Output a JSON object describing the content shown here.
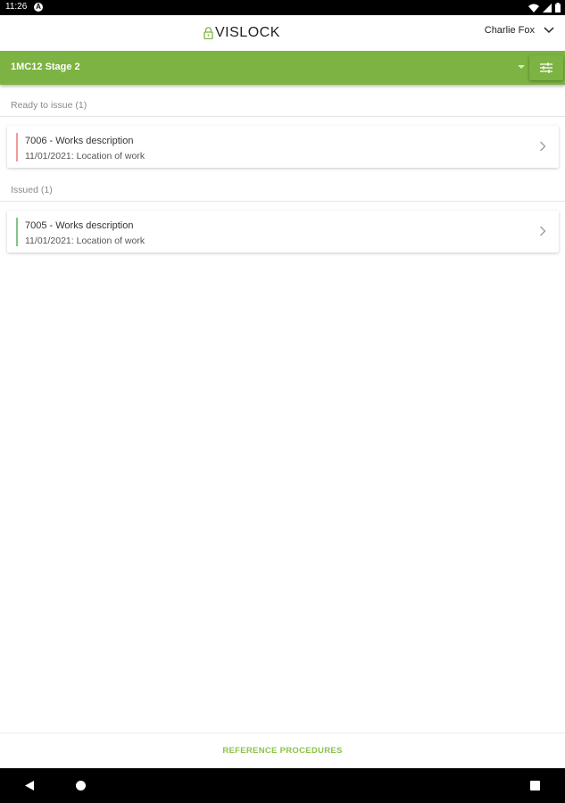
{
  "status_bar": {
    "time": "11:26",
    "notification_icon": "a-circle-icon",
    "icons": [
      "wifi-icon",
      "signal-icon",
      "battery-icon"
    ]
  },
  "header": {
    "logo_text": "VISLOCK",
    "logo_icon": "lock-icon",
    "user_name": "Charlie Fox",
    "user_menu_icon": "chevron-down-icon"
  },
  "toolbar": {
    "project": "1MC12 Stage 2",
    "filter_icon": "sliders-icon"
  },
  "sections": [
    {
      "label": "Ready to issue (1)",
      "items": [
        {
          "title": "7006 - Works description",
          "subtitle": "11/01/2021: Location of work",
          "status_color": "#ef9a9a"
        }
      ]
    },
    {
      "label": "Issued (1)",
      "items": [
        {
          "title": "7005 - Works description",
          "subtitle": "11/01/2021: Location of work",
          "status_color": "#81c784"
        }
      ]
    }
  ],
  "footer": {
    "reference_label": "REFERENCE PROCEDURES"
  },
  "colors": {
    "accent": "#7cb342",
    "link": "#8bc34a"
  },
  "nav_bar": {
    "icons": [
      "back-icon",
      "home-icon",
      "recents-icon"
    ]
  }
}
